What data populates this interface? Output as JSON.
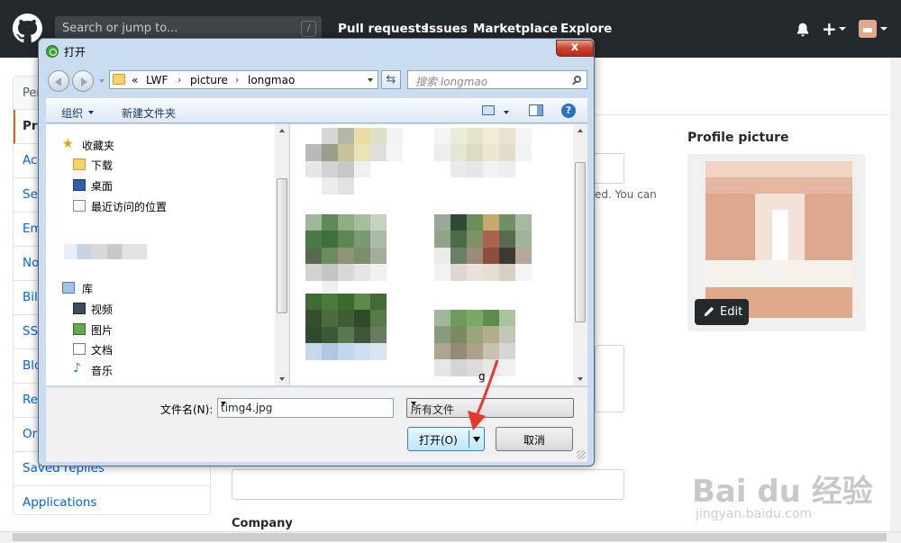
{
  "github": {
    "search_placeholder": "Search or jump to...",
    "search_shortcut": "/",
    "nav": [
      "Pull requests",
      "Issues",
      "Marketplace",
      "Explore"
    ],
    "plus_symbol": "+"
  },
  "settings": {
    "sidebar_header": "Per",
    "sidebar_items": [
      "Pro",
      "Acc",
      "Sec",
      "Em",
      "No",
      "Bill",
      "SSH",
      "Blo",
      "Re",
      "Or",
      "Saved replies",
      "Applications"
    ],
    "fragment_text": "ed. You can",
    "profile_picture_label": "Profile picture",
    "edit_label": "Edit",
    "company_label": "Company"
  },
  "dialog": {
    "title": "打开",
    "close_symbol": "x",
    "breadcrumb": [
      "«",
      "LWF",
      "picture",
      "longmao"
    ],
    "search_placeholder": "搜索 longmao",
    "toolbar": {
      "organize": "组织",
      "new_folder": "新建文件夹",
      "help": "?"
    },
    "nav_favorites": {
      "header": "收藏夹",
      "items": [
        "下载",
        "桌面",
        "最近访问的位置"
      ]
    },
    "nav_library": {
      "header": "库",
      "items": [
        "视频",
        "图片",
        "文档",
        "音乐"
      ]
    },
    "file_label": "g",
    "filename_label": "文件名(N):",
    "filename_value": "timg4.jpg",
    "filetype_value": "所有文件",
    "open_label": "打开(O)",
    "cancel_label": "取消"
  },
  "watermark": {
    "main": "Bai du 经验",
    "sub": "jingyan.baidu.com"
  }
}
